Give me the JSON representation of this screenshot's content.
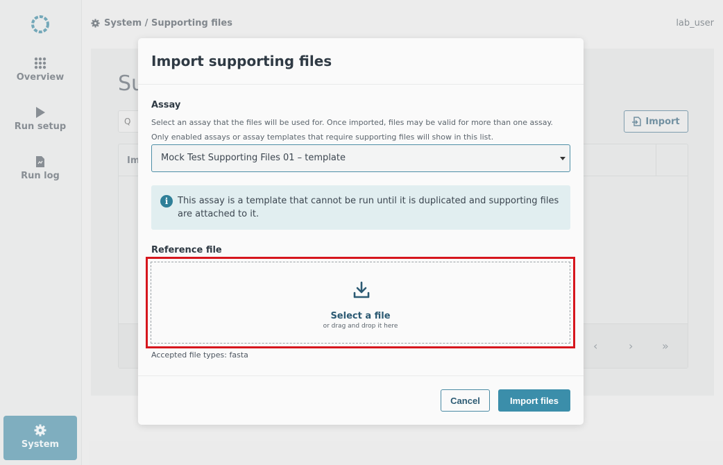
{
  "sidebar": {
    "items": [
      {
        "label": "Overview",
        "icon": "grid-icon"
      },
      {
        "label": "Run setup",
        "icon": "play-icon"
      },
      {
        "label": "Run log",
        "icon": "document-icon"
      },
      {
        "label": "System",
        "icon": "gear-icon"
      }
    ]
  },
  "header": {
    "breadcrumb": "System / Supporting files",
    "user": "lab_user"
  },
  "background": {
    "page_title": "Su",
    "search_glyph": "Q",
    "import_label": "Import",
    "table_header_first": "Im"
  },
  "modal": {
    "title": "Import supporting files",
    "assay_label": "Assay",
    "assay_help_1": "Select an assay that the files will be used for. Once imported, files may be valid for more than one assay.",
    "assay_help_2": "Only enabled assays or assay templates that require supporting files will show in this list.",
    "assay_selected": "Mock Test Supporting Files 01 – template",
    "info_text": "This assay is a template that cannot be run until it is duplicated and supporting files are attached to it.",
    "reference_label": "Reference file",
    "drop_main": "Select a file",
    "drop_sub": "or drag and drop it here",
    "accepted": "Accepted file types: fasta",
    "cancel_label": "Cancel",
    "import_label": "Import files"
  },
  "colors": {
    "accent": "#3b8eaa",
    "highlight": "#d6161d",
    "sidebar_active": "#3f87a1"
  }
}
